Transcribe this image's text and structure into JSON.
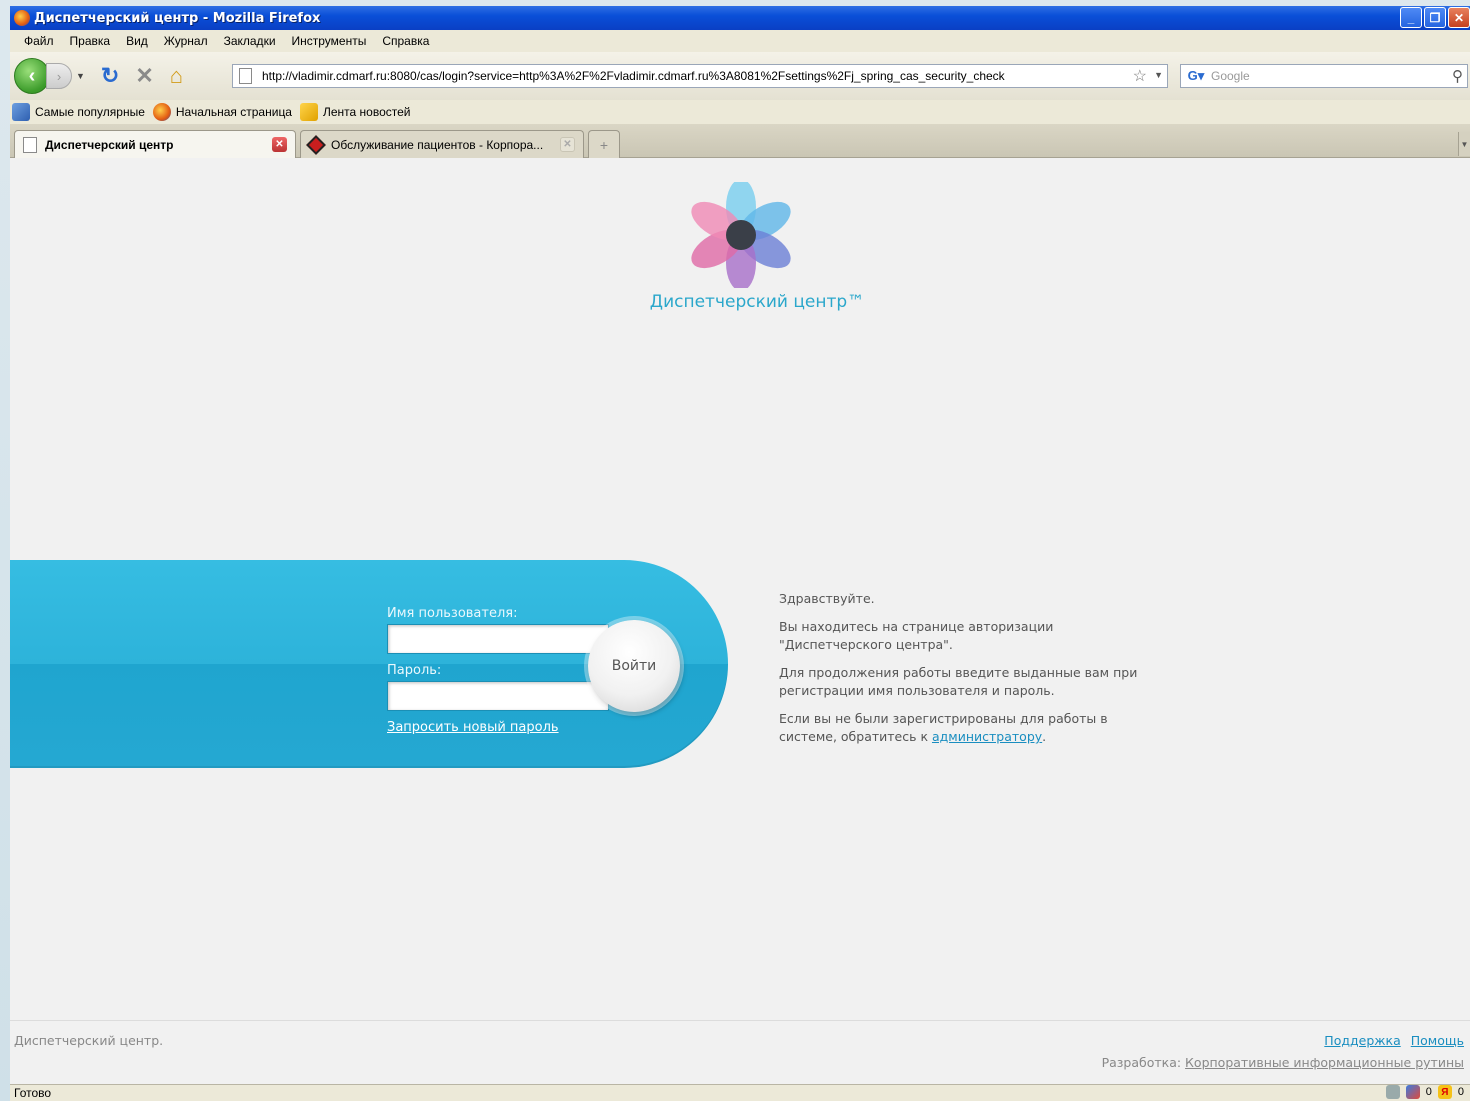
{
  "window": {
    "title": "Диспетчерский центр - Mozilla Firefox",
    "controls": [
      "minimize",
      "maximize",
      "close"
    ]
  },
  "menu": [
    "Файл",
    "Правка",
    "Вид",
    "Журнал",
    "Закладки",
    "Инструменты",
    "Справка"
  ],
  "nav": {
    "url": "http://vladimir.cdmarf.ru:8080/cas/login?service=http%3A%2F%2Fvladimir.cdmarf.ru%3A8081%2Fsettings%2Fj_spring_cas_security_check",
    "search_placeholder": "Google"
  },
  "bookmarks": [
    "Самые популярные",
    "Начальная страница",
    "Лента новостей"
  ],
  "tabs": [
    {
      "label": "Диспетчерский центр",
      "active": true
    },
    {
      "label": "Обслуживание пациентов - Корпора...",
      "active": false
    }
  ],
  "page": {
    "logo_text": "Диспетчерский центр™",
    "login": {
      "username_label": "Имя пользователя:",
      "username_value": "",
      "password_label": "Пароль:",
      "password_value": "",
      "submit_label": "Войти",
      "reset_link": "Запросить новый пароль"
    },
    "info": {
      "greeting": "Здравствуйте.",
      "p1": "Вы находитесь на странице авторизации \"Диспетчерского центра\".",
      "p2": "Для продолжения работы введите выданные вам при регистрации имя пользователя и пароль.",
      "p3_prefix": "Если вы не были зарегистрированы для работы в системе, обратитесь к ",
      "p3_link": "администратору",
      "p3_suffix": "."
    },
    "footer": {
      "left": "Диспетчерский центр.",
      "support_link": "Поддержка",
      "help_link": "Помощь",
      "dev_prefix": "Разработка: ",
      "dev_link": "Корпоративные информационные рутины"
    }
  },
  "status": {
    "text": "Готово",
    "tray_counts": [
      "0",
      "0"
    ],
    "yandex_letter": "Я"
  },
  "colors": {
    "accent": "#2db3da",
    "link": "#1a8ec0",
    "title_bar": "#0a4fd8"
  }
}
